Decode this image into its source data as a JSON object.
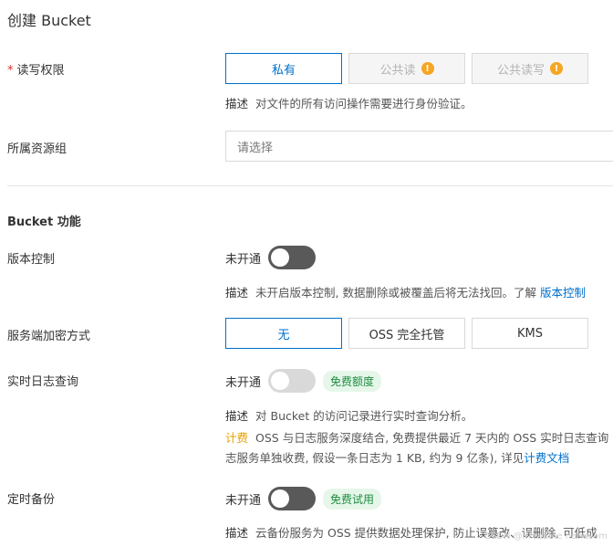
{
  "page": {
    "title": "创建 Bucket"
  },
  "acl": {
    "label": "读写权限",
    "required_mark": "*",
    "options": [
      "私有",
      "公共读",
      "公共读写"
    ],
    "warn_icon": "!",
    "desc_label": "描述",
    "desc_text": "对文件的所有访问操作需要进行身份验证。"
  },
  "resource_group": {
    "label": "所属资源组",
    "placeholder": "请选择"
  },
  "features": {
    "title": "Bucket 功能"
  },
  "versioning": {
    "label": "版本控制",
    "state": "未开通",
    "desc_label": "描述",
    "desc_text": "未开启版本控制, 数据删除或被覆盖后将无法找回。了解",
    "link": "版本控制"
  },
  "encryption": {
    "label": "服务端加密方式",
    "options": [
      "无",
      "OSS 完全托管",
      "KMS"
    ]
  },
  "realtime_log": {
    "label": "实时日志查询",
    "state": "未开通",
    "badge": "免费额度",
    "desc_label": "描述",
    "desc_text": "对 Bucket 的访问记录进行实时查询分析。",
    "fee_label": "计费",
    "fee_line1": "OSS 与日志服务深度结合, 免费提供最近 7 天内的 OSS 实时日志查询",
    "fee_line2": "志服务单独收费, 假设一条日志为 1 KB, 约为 9 亿条), 详见",
    "fee_link": "计费文档"
  },
  "backup": {
    "label": "定时备份",
    "state": "未开通",
    "badge": "免费试用",
    "desc_label": "描述",
    "desc_text": "云备份服务为 OSS 提供数据处理保护, 防止误篡改、误删除, 可低成"
  },
  "watermark": "CSDN @irrestible handsom",
  "colors": {
    "accent": "#0070cc",
    "required": "#d93026",
    "fee": "#e6a100",
    "badge_bg": "#e6f7ea",
    "badge_text": "#1d8c3e"
  }
}
